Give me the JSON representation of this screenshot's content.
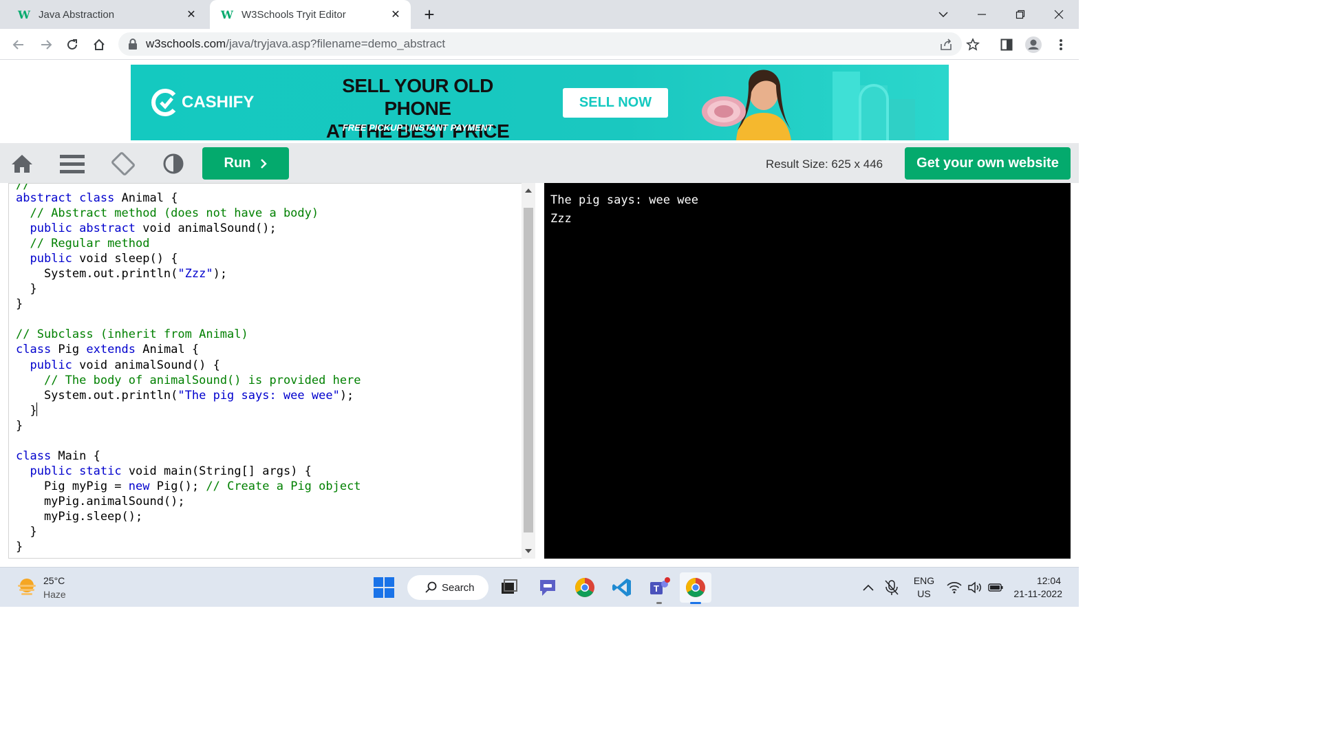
{
  "browser": {
    "tabs": [
      {
        "title": "Java Abstraction",
        "favicon": "w3schools-icon",
        "active": false
      },
      {
        "title": "W3Schools Tryit Editor",
        "favicon": "w3schools-icon",
        "active": true
      }
    ],
    "url_host": "w3schools.com",
    "url_path": "/java/tryjava.asp?filename=demo_abstract"
  },
  "ad": {
    "brand": "CASHIFY",
    "headline_1": "SELL YOUR OLD PHONE",
    "headline_2": "AT THE BEST PRICE",
    "subline": "FREE PICKUP | INSTANT PAYMENT",
    "cta": "SELL NOW",
    "accent": "#14c9c0"
  },
  "editor_toolbar": {
    "run_label": "Run",
    "result_size": "Result Size: 625 x 446",
    "get_website": "Get your own website",
    "accent": "#04AA6D"
  },
  "code_lines": [
    "abstract class Animal {",
    "  // Abstract method (does not have a body)",
    "  public abstract void animalSound();",
    "  // Regular method",
    "  public void sleep() {",
    "    System.out.println(\"Zzz\");",
    "  }",
    "}",
    "",
    "// Subclass (inherit from Animal)",
    "class Pig extends Animal {",
    "  public void animalSound() {",
    "    // The body of animalSound() is provided here",
    "    System.out.println(\"The pig says: wee wee\");",
    "  }",
    "}",
    "",
    "class Main {",
    "  public static void main(String[] args) {",
    "    Pig myPig = new Pig(); // Create a Pig object",
    "    myPig.animalSound();",
    "    myPig.sleep();",
    "  }",
    "}"
  ],
  "output_lines": [
    "The pig says: wee wee",
    "Zzz"
  ],
  "taskbar": {
    "weather_temp": "25°C",
    "weather_desc": "Haze",
    "search_label": "Search",
    "lang_1": "ENG",
    "lang_2": "US",
    "time": "12:04",
    "date": "21-11-2022"
  }
}
